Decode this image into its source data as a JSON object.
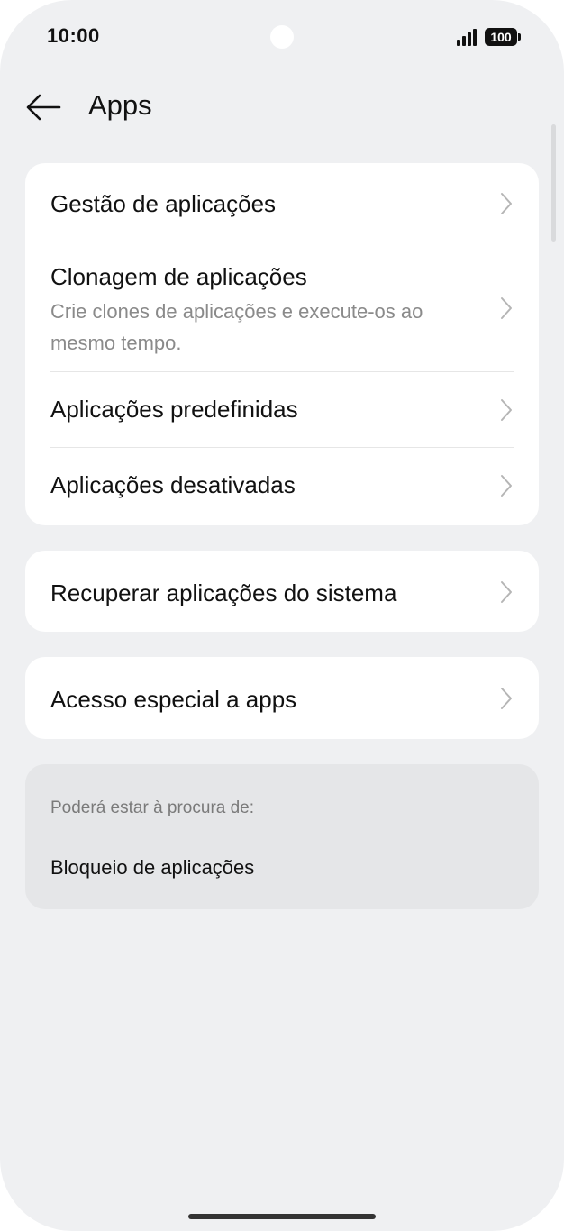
{
  "status_bar": {
    "time": "10:00",
    "battery": "100",
    "signal_icon": "signal-bars-icon"
  },
  "header": {
    "back_icon": "arrow-left-icon",
    "title": "Apps"
  },
  "group1": {
    "items": [
      {
        "title": "Gestão de aplicações"
      },
      {
        "title": "Clonagem de aplicações",
        "subtitle": "Crie clones de aplicações e execute-os ao mesmo tempo."
      },
      {
        "title": "Aplicações predefinidas"
      },
      {
        "title": "Aplicações desativadas"
      }
    ]
  },
  "group2": {
    "items": [
      {
        "title": "Recuperar aplicações do sistema"
      }
    ]
  },
  "group3": {
    "items": [
      {
        "title": "Acesso especial a apps"
      }
    ]
  },
  "suggestions": {
    "label": "Poderá estar à procura de:",
    "items": [
      {
        "title": "Bloqueio de aplicações"
      }
    ]
  },
  "colors": {
    "background": "#eff0f2",
    "card": "#ffffff",
    "suggest_card": "#e5e6e8",
    "text_primary": "#111111",
    "text_secondary": "#8a8a8a"
  }
}
